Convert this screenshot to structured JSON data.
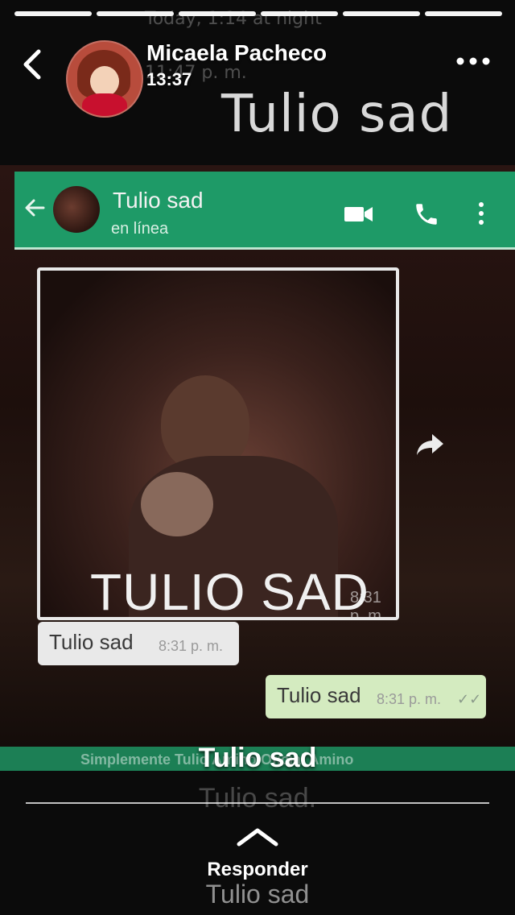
{
  "story": {
    "user_name": "Micaela Pacheco",
    "time": "13:37",
    "caption": "Tulio sad",
    "reply_label": "Responder",
    "progress_segments": 6,
    "icons": [
      "back-chevron-icon",
      "more-dots-icon",
      "reply-chevron-icon"
    ]
  },
  "background": {
    "ghost_top": "Today, 1:14 at night",
    "ghost_mid": "11:47 p. m.",
    "title": "Tulio sad",
    "ghost_caption": "Tulio sad.",
    "ghost_bottom": "Tulio sad"
  },
  "whatsapp": {
    "contact_name": "Tulio sad",
    "contact_status": "en línea",
    "image_caption": "TULIO SAD",
    "image_time": "8:31 p. m.",
    "messages": [
      {
        "text": "Tulio sad",
        "time": "8:31 p. m."
      },
      {
        "text": "Tulio sad",
        "time": "8:31 p. m."
      }
    ],
    "footer_text": "Simplemente Tulio Amino Oficial Amino",
    "colors": {
      "header": "#1e9a67",
      "incoming_bubble": "#e9e9e9",
      "outgoing_bubble": "#d4ebc0"
    }
  }
}
